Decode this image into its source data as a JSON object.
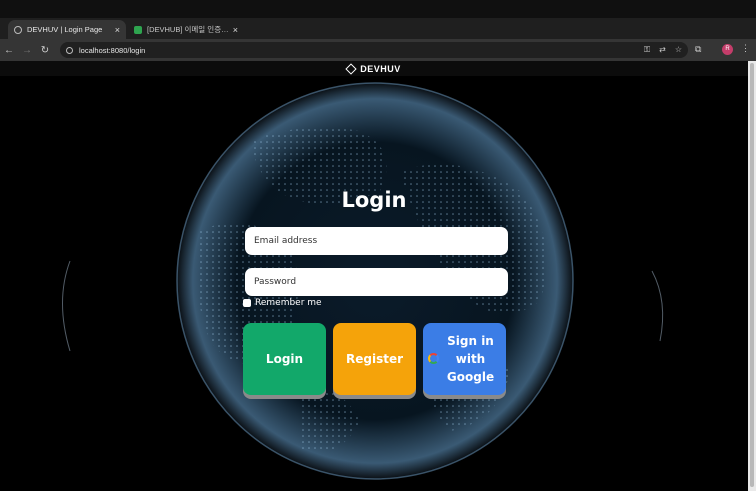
{
  "browser": {
    "tabs": [
      {
        "label": "DEVHUV | Login Page",
        "active": true
      },
      {
        "label": "[DEVHUB] 이메일 인증 요청 메일",
        "active": false
      }
    ],
    "new_tab": "+",
    "url": "localhost:8080/login",
    "profile_initial": "R"
  },
  "navbar": {
    "brand": "DEVHUV"
  },
  "login": {
    "title": "Login",
    "email_placeholder": "Email address",
    "password_placeholder": "Password",
    "remember_label": "Remember me",
    "login_button": "Login",
    "register_button": "Register",
    "google_button": "Sign in with Google"
  },
  "colors": {
    "login_button": "#12a86a",
    "register_button": "#f5a30a",
    "google_button": "#3b7de6"
  }
}
